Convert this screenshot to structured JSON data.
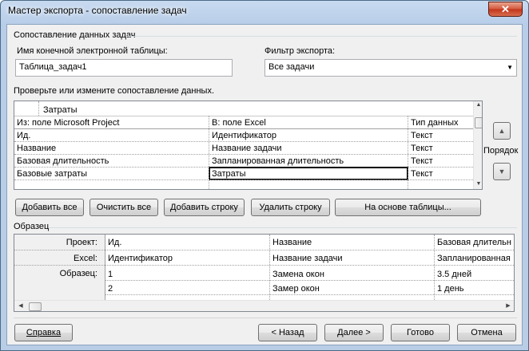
{
  "window": {
    "title": "Мастер экспорта - сопоставление задач",
    "close_glyph": "✕"
  },
  "section": {
    "title": "Сопоставление данных задач"
  },
  "dest_table": {
    "label": "Имя конечной электронной таблицы:",
    "value": "Таблица_задач1"
  },
  "export_filter": {
    "label": "Фильтр экспорта:",
    "value": "Все задачи"
  },
  "mapping": {
    "instruction": "Проверьте или измените сопоставление данных.",
    "edit_value": "Затраты",
    "headers": {
      "from": "Из: поле Microsoft Project",
      "to": "В:  поле Excel",
      "type": "Тип данных"
    },
    "rows": [
      {
        "from": "Ид.",
        "to": "Идентификатор",
        "type": "Текст"
      },
      {
        "from": "Название",
        "to": "Название задачи",
        "type": "Текст"
      },
      {
        "from": "Базовая длительность",
        "to": "Запланированная длительность",
        "type": "Текст"
      },
      {
        "from": "Базовые затраты",
        "to": "Затраты",
        "type": "Текст"
      }
    ]
  },
  "order": {
    "label": "Порядок",
    "up_icon": "up-arrow-icon",
    "down_icon": "down-arrow-icon"
  },
  "actions": {
    "add_all": "Добавить все",
    "clear_all": "Очистить все",
    "add_row": "Добавить строку",
    "delete_row": "Удалить строку",
    "based_on_table": "На основе таблицы..."
  },
  "sample": {
    "title": "Образец",
    "row_headers": {
      "project": "Проект:",
      "excel": "Excel:",
      "sample": "Образец:"
    },
    "columns": [
      {
        "project": "Ид.",
        "excel": "Идентификатор",
        "values": [
          "1",
          "2"
        ]
      },
      {
        "project": "Название",
        "excel": "Название задачи",
        "values": [
          "Замена окон",
          "Замер окон"
        ]
      },
      {
        "project": "Базовая длительн",
        "excel": "Запланированная",
        "values": [
          "3.5 дней",
          "1 день"
        ]
      }
    ]
  },
  "footer": {
    "help": "Справка",
    "back": "< Назад",
    "next": "Далее >",
    "finish": "Готово",
    "cancel": "Отмена"
  }
}
